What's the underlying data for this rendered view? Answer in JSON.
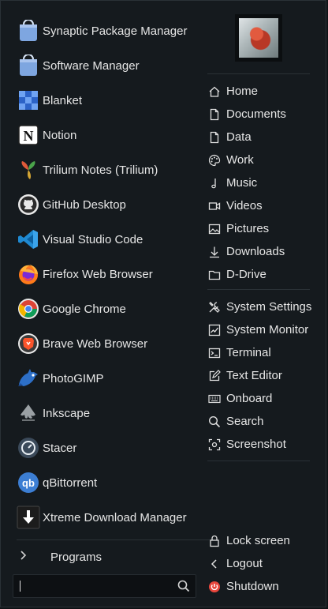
{
  "apps": [
    {
      "label": "Synaptic Package Manager",
      "icon": "synaptic-icon"
    },
    {
      "label": "Software Manager",
      "icon": "software-manager-icon"
    },
    {
      "label": "Blanket",
      "icon": "blanket-icon"
    },
    {
      "label": "Notion",
      "icon": "notion-icon"
    },
    {
      "label": "Trilium Notes (Trilium)",
      "icon": "trilium-icon"
    },
    {
      "label": "GitHub Desktop",
      "icon": "github-icon"
    },
    {
      "label": "Visual Studio Code",
      "icon": "vscode-icon"
    },
    {
      "label": "Firefox Web Browser",
      "icon": "firefox-icon"
    },
    {
      "label": "Google Chrome",
      "icon": "chrome-icon"
    },
    {
      "label": "Brave Web Browser",
      "icon": "brave-icon"
    },
    {
      "label": "PhotoGIMP",
      "icon": "photogimp-icon"
    },
    {
      "label": "Inkscape",
      "icon": "inkscape-icon"
    },
    {
      "label": "Stacer",
      "icon": "stacer-icon"
    },
    {
      "label": "qBittorrent",
      "icon": "qbittorrent-icon"
    },
    {
      "label": "Xtreme Download Manager",
      "icon": "xdm-icon"
    }
  ],
  "programs": {
    "label": "Programs"
  },
  "search": {
    "value": "",
    "placeholder": ""
  },
  "places": [
    {
      "label": "Home",
      "icon": "home-icon"
    },
    {
      "label": "Documents",
      "icon": "document-icon"
    },
    {
      "label": "Data",
      "icon": "document-icon"
    },
    {
      "label": "Work",
      "icon": "palette-icon"
    },
    {
      "label": "Music",
      "icon": "music-note-icon"
    },
    {
      "label": "Videos",
      "icon": "video-icon"
    },
    {
      "label": "Pictures",
      "icon": "picture-icon"
    },
    {
      "label": "Downloads",
      "icon": "download-icon"
    },
    {
      "label": "D-Drive",
      "icon": "folder-icon"
    }
  ],
  "system": [
    {
      "label": "System Settings",
      "icon": "tools-icon"
    },
    {
      "label": "System Monitor",
      "icon": "monitor-chart-icon"
    },
    {
      "label": "Terminal",
      "icon": "terminal-icon"
    },
    {
      "label": "Text Editor",
      "icon": "edit-icon"
    },
    {
      "label": "Onboard",
      "icon": "keyboard-icon"
    },
    {
      "label": "Search",
      "icon": "search-icon"
    },
    {
      "label": "Screenshot",
      "icon": "screenshot-icon"
    }
  ],
  "session": [
    {
      "label": "Lock screen",
      "icon": "lock-icon"
    },
    {
      "label": "Logout",
      "icon": "chevron-left-icon"
    },
    {
      "label": "Shutdown",
      "icon": "power-icon"
    }
  ],
  "colors": {
    "background": "#151a1e",
    "text": "#e6e6e6",
    "separator": "#2a3136",
    "shutdown": "#e8463c"
  }
}
